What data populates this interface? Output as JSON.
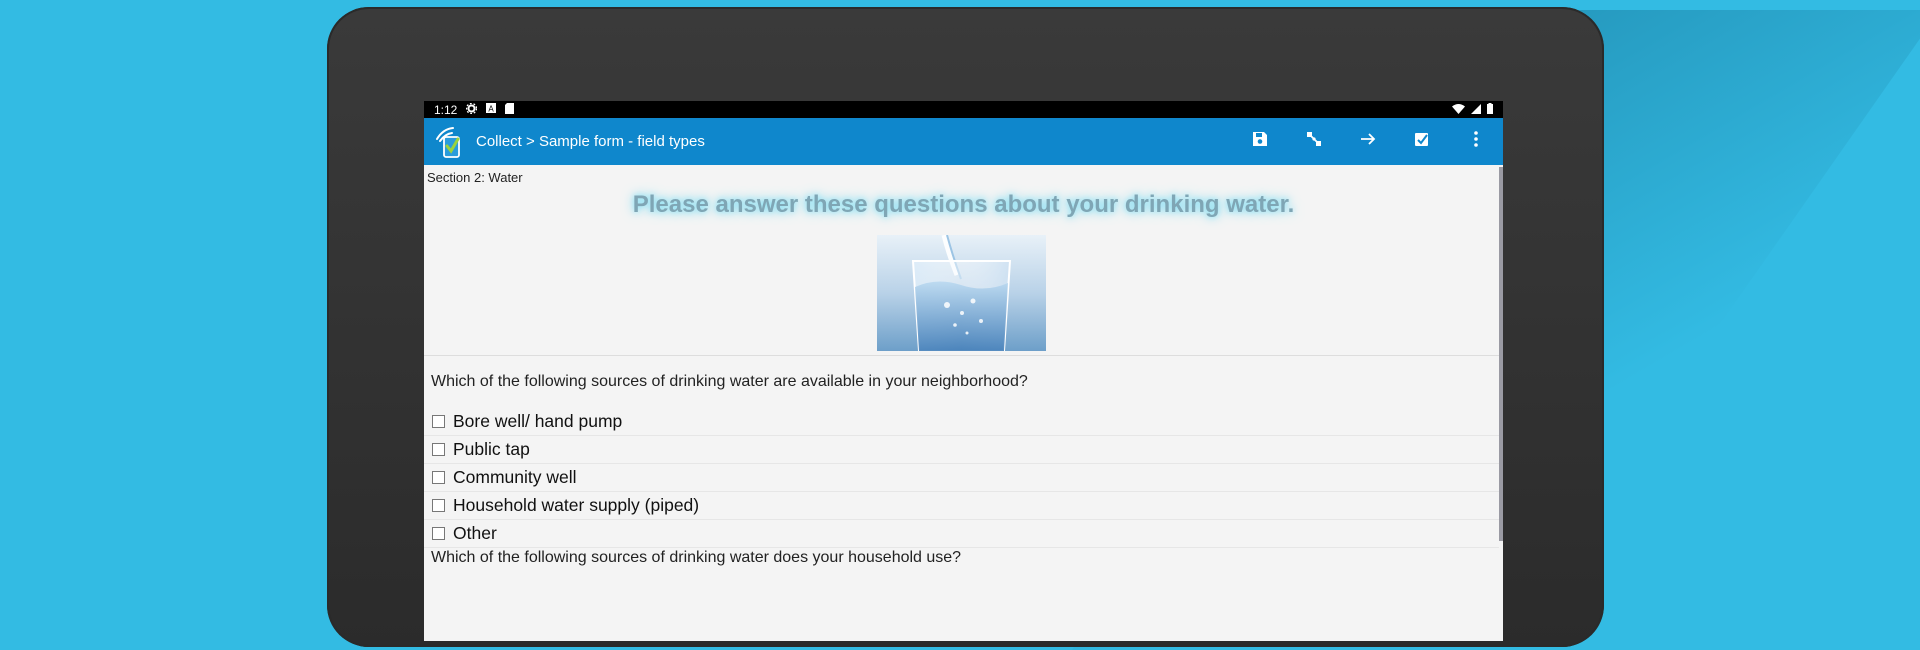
{
  "statusbar": {
    "time": "1:12",
    "left_icons": [
      "gear-icon",
      "a-box-icon",
      "sd-card-icon"
    ],
    "right_icons": [
      "wifi-icon",
      "signal-icon",
      "battery-icon"
    ]
  },
  "appbar": {
    "title": "Collect > Sample form - field types",
    "background": "#0f87cc",
    "actions": [
      "save-icon",
      "hierarchy-icon",
      "arrow-right-icon",
      "checklist-icon",
      "more-vert-icon"
    ]
  },
  "form": {
    "section_label": "Section 2: Water",
    "heading": "Please answer these questions about your drinking water.",
    "image_subject": "glass-of-water",
    "question1": "Which of the following sources of drinking water are available in your neighborhood?",
    "options": [
      {
        "label": "Bore well/ hand pump",
        "checked": false
      },
      {
        "label": "Public tap",
        "checked": false
      },
      {
        "label": "Community well",
        "checked": false
      },
      {
        "label": "Household water supply (piped)",
        "checked": false
      },
      {
        "label": "Other",
        "checked": false
      }
    ],
    "question2": "Which of the following sources of drinking water does your household use?"
  },
  "colors": {
    "background": "#33bbe3",
    "device_frame": "#333333",
    "heading_glow": "#74d8ef"
  }
}
